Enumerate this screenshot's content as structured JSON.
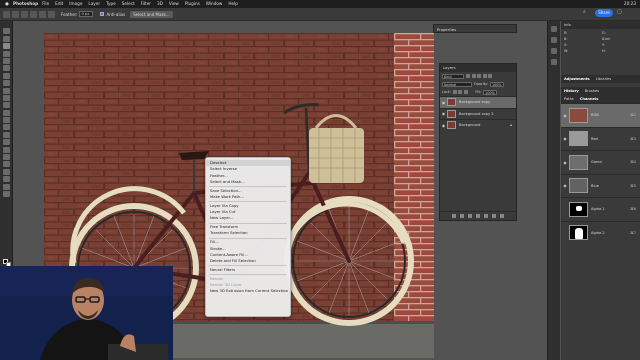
{
  "menubar": {
    "app_name": "Photoshop",
    "items": [
      "File",
      "Edit",
      "Image",
      "Layer",
      "Type",
      "Select",
      "Filter",
      "3D",
      "View",
      "Plugins",
      "Window",
      "Help"
    ],
    "clock": "20:23"
  },
  "options_bar": {
    "feather_label": "Feather:",
    "feather_value": "0 px",
    "anti_alias_label": "Anti-alias",
    "select_mask_label": "Select and Mask...",
    "share_label": "Share"
  },
  "context_menu": {
    "groups": [
      [
        "Deselect",
        "Select Inverse",
        "Feather...",
        "Select and Mask..."
      ],
      [
        "Save Selection...",
        "Make Work Path..."
      ],
      [
        "Layer Via Copy",
        "Layer Via Cut",
        "New Layer..."
      ],
      [
        "Free Transform",
        "Transform Selection"
      ],
      [
        "Fill...",
        "Stroke...",
        "Content-Aware Fill...",
        "Delete and Fill Selection"
      ],
      [
        "Neural Filters"
      ],
      [
        "Render",
        "Render 3D Layer",
        "New 3D Extrusion from Current Selection"
      ]
    ],
    "highlighted": "Deselect",
    "disabled": [
      "Render",
      "Render 3D Layer"
    ]
  },
  "properties": {
    "title": "Properties"
  },
  "layers_panel": {
    "title": "Layers",
    "kind_label": "Kind",
    "blend_mode": "Normal",
    "opacity_label": "Opacity:",
    "opacity_value": "100%",
    "lock_label": "Lock:",
    "fill_label": "Fill:",
    "fill_value": "100%",
    "layers": [
      {
        "name": "Background copy",
        "active": true
      },
      {
        "name": "Background copy 2",
        "active": false
      },
      {
        "name": "Background",
        "active": false,
        "locked": true
      }
    ]
  },
  "info_panel": {
    "tabs": "Info",
    "rows": [
      "R:",
      "G:",
      "B:",
      "8-bit",
      "X:",
      "Y:",
      "W:",
      "H:"
    ]
  },
  "adjustments_tabs": [
    "Adjustments",
    "Libraries"
  ],
  "history_tabs": [
    "History",
    "Brushes"
  ],
  "channels_panel": {
    "tabs": [
      "Paths",
      "Channels"
    ],
    "channels": [
      {
        "name": "RGB",
        "key": "⌘2",
        "active": true
      },
      {
        "name": "Red",
        "key": "⌘3",
        "active": false
      },
      {
        "name": "Green",
        "key": "⌘4",
        "active": false
      },
      {
        "name": "Blue",
        "key": "⌘5",
        "active": false
      },
      {
        "name": "Alpha 1",
        "key": "⌘6",
        "active": false
      },
      {
        "name": "Alpha 2",
        "key": "⌘7",
        "active": false
      }
    ]
  }
}
